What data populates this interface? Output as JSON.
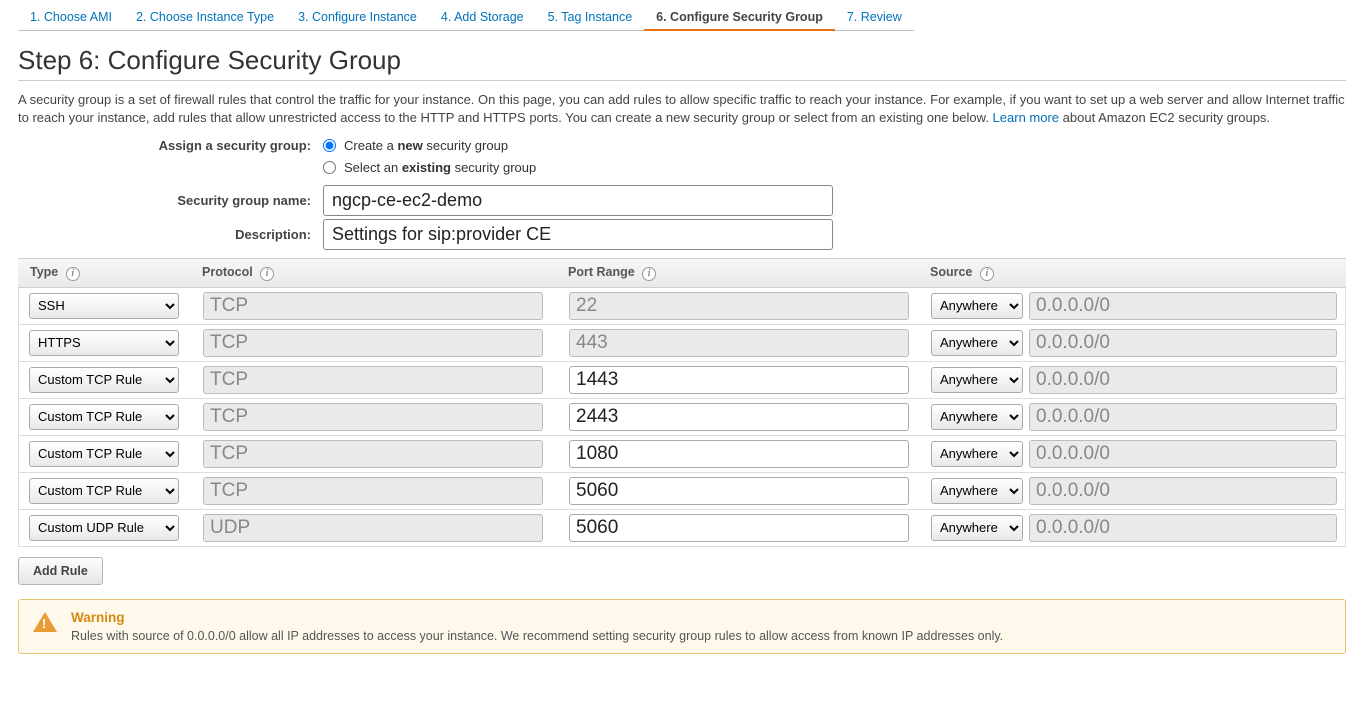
{
  "tabs": [
    {
      "label": "1. Choose AMI"
    },
    {
      "label": "2. Choose Instance Type"
    },
    {
      "label": "3. Configure Instance"
    },
    {
      "label": "4. Add Storage"
    },
    {
      "label": "5. Tag Instance"
    },
    {
      "label": "6. Configure Security Group",
      "active": true
    },
    {
      "label": "7. Review"
    }
  ],
  "step": {
    "title": "Step 6: Configure Security Group",
    "description_pre": "A security group is a set of firewall rules that control the traffic for your instance. On this page, you can add rules to allow specific traffic to reach your instance. For example, if you want to set up a web server and allow Internet traffic to reach your instance, add rules that allow unrestricted access to the HTTP and HTTPS ports. You can create a new security group or select from an existing one below. ",
    "learn_more": "Learn more",
    "description_post": " about Amazon EC2 security groups."
  },
  "assign": {
    "label": "Assign a security group:",
    "opt_create_pre": "Create a ",
    "opt_create_bold": "new",
    "opt_create_post": " security group",
    "opt_existing_pre": "Select an ",
    "opt_existing_bold": "existing",
    "opt_existing_post": " security group",
    "selected": "create"
  },
  "sg_name": {
    "label": "Security group name:",
    "value": "ngcp-ce-ec2-demo"
  },
  "sg_desc": {
    "label": "Description:",
    "value": "Settings for sip:provider CE"
  },
  "headers": {
    "type": "Type",
    "protocol": "Protocol",
    "port": "Port Range",
    "source": "Source"
  },
  "rules": [
    {
      "type": "SSH",
      "protocol": "TCP",
      "port": "22",
      "port_editable": false,
      "source_sel": "Anywhere",
      "source_ip": "0.0.0.0/0"
    },
    {
      "type": "HTTPS",
      "protocol": "TCP",
      "port": "443",
      "port_editable": false,
      "source_sel": "Anywhere",
      "source_ip": "0.0.0.0/0"
    },
    {
      "type": "Custom TCP Rule",
      "protocol": "TCP",
      "port": "1443",
      "port_editable": true,
      "source_sel": "Anywhere",
      "source_ip": "0.0.0.0/0"
    },
    {
      "type": "Custom TCP Rule",
      "protocol": "TCP",
      "port": "2443",
      "port_editable": true,
      "source_sel": "Anywhere",
      "source_ip": "0.0.0.0/0"
    },
    {
      "type": "Custom TCP Rule",
      "protocol": "TCP",
      "port": "1080",
      "port_editable": true,
      "source_sel": "Anywhere",
      "source_ip": "0.0.0.0/0"
    },
    {
      "type": "Custom TCP Rule",
      "protocol": "TCP",
      "port": "5060",
      "port_editable": true,
      "source_sel": "Anywhere",
      "source_ip": "0.0.0.0/0"
    },
    {
      "type": "Custom UDP Rule",
      "protocol": "UDP",
      "port": "5060",
      "port_editable": true,
      "source_sel": "Anywhere",
      "source_ip": "0.0.0.0/0"
    }
  ],
  "add_rule_label": "Add Rule",
  "warning": {
    "title": "Warning",
    "text": "Rules with source of 0.0.0.0/0 allow all IP addresses to access your instance. We recommend setting security group rules to allow access from known IP addresses only."
  }
}
